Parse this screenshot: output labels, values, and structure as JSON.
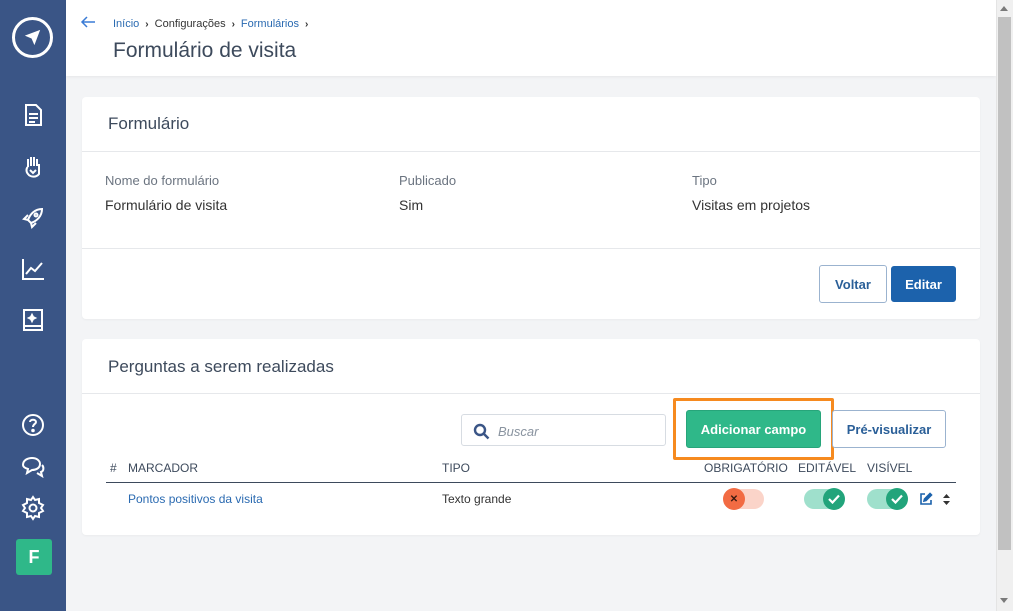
{
  "sidebar": {
    "icons": [
      "logo-icon",
      "document-icon",
      "hand-icon",
      "rocket-icon",
      "chart-icon",
      "book-icon",
      "help-icon",
      "chat-icon",
      "gear-icon"
    ],
    "avatar_letter": "F",
    "background": "#3a5586"
  },
  "header": {
    "breadcrumb": [
      "Início",
      "Configurações",
      "Formulários"
    ],
    "title": "Formulário de visita"
  },
  "form_card": {
    "title": "Formulário",
    "fields": [
      {
        "label": "Nome do formulário",
        "value": "Formulário de visita"
      },
      {
        "label": "Publicado",
        "value": "Sim"
      },
      {
        "label": "Tipo",
        "value": "Visitas em projetos"
      }
    ],
    "back_label": "Voltar",
    "edit_label": "Editar"
  },
  "questions_card": {
    "title": "Perguntas a serem realizadas",
    "search_placeholder": "Buscar",
    "add_label": "Adicionar campo",
    "preview_label": "Pré-visualizar",
    "columns": [
      "#",
      "MARCADOR",
      "TIPO",
      "OBRIGATÓRIO",
      "EDITÁVEL",
      "VISÍVEL"
    ],
    "rows": [
      {
        "marker": "Pontos positivos da visita",
        "type": "Texto grande",
        "required": false,
        "editable": true,
        "visible": true
      }
    ]
  },
  "colors": {
    "accent": "#1c62ac",
    "green": "#2fb889",
    "highlight": "#f68a1f"
  }
}
